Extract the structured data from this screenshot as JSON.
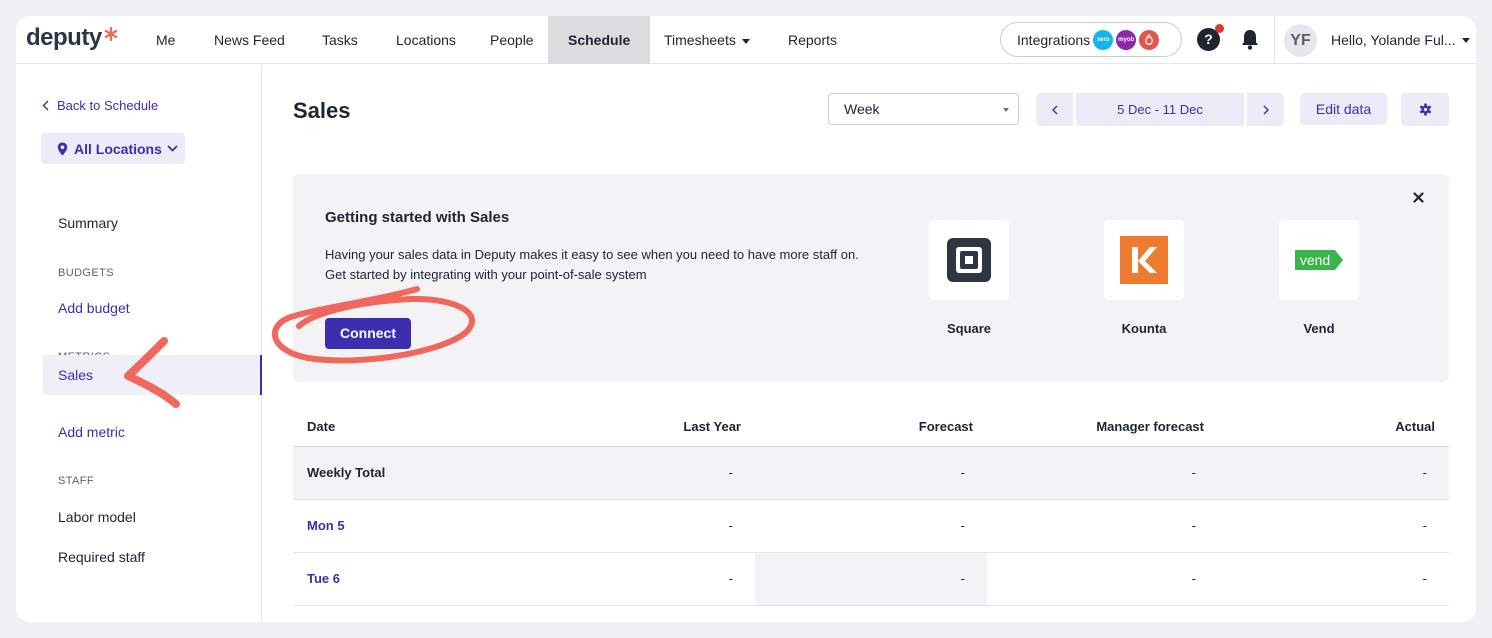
{
  "nav": {
    "brand": "deputy",
    "items": [
      {
        "label": "Me"
      },
      {
        "label": "News Feed"
      },
      {
        "label": "Tasks"
      },
      {
        "label": "Locations"
      },
      {
        "label": "People"
      },
      {
        "label": "Schedule"
      },
      {
        "label": "Timesheets"
      },
      {
        "label": "Reports"
      }
    ],
    "integrations_label": "Integrations",
    "integration_logos": [
      {
        "text": "xero",
        "color": "#13b5ea"
      },
      {
        "text": "myob",
        "color": "#8a2aa6"
      },
      {
        "text": "",
        "color": "#e2574c"
      }
    ],
    "help_icon": "?",
    "avatar_initials": "YF",
    "greeting": "Hello, Yolande Ful..."
  },
  "sidebar": {
    "back_label": "Back to Schedule",
    "location_label": "All Locations",
    "summary": "Summary",
    "budgets_heading": "BUDGETS",
    "add_budget": "Add budget",
    "metrics_heading": "METRICS",
    "sales": "Sales",
    "add_metric": "Add metric",
    "staff_heading": "STAFF",
    "labor_model": "Labor model",
    "required_staff": "Required staff"
  },
  "main": {
    "title": "Sales",
    "period_select": "Week",
    "date_range": "5 Dec - 11 Dec",
    "edit_label": "Edit data"
  },
  "card": {
    "title": "Getting started with Sales",
    "line1": "Having your sales data in Deputy makes it easy to see when you need to have more staff on.",
    "line2": "Get started by integrating with your point-of-sale system",
    "connect_label": "Connect",
    "vend_logo_text": "vend",
    "integrations": [
      {
        "name": "Square"
      },
      {
        "name": "Kounta"
      },
      {
        "name": "Vend"
      }
    ]
  },
  "table": {
    "headers": [
      "Date",
      "Last Year",
      "Forecast",
      "Manager forecast",
      "Actual"
    ],
    "rows": [
      {
        "date": "Weekly Total",
        "last_year": "-",
        "forecast": "-",
        "manager_forecast": "-",
        "actual": "-"
      },
      {
        "date": "Mon 5",
        "last_year": "-",
        "forecast": "-",
        "manager_forecast": "-",
        "actual": "-"
      },
      {
        "date": "Tue 6",
        "last_year": "-",
        "forecast": "-",
        "manager_forecast": "-",
        "actual": "-"
      }
    ]
  },
  "colors": {
    "accent": "#3d2eb0",
    "accent_light": "#ecebf7",
    "annotation": "#f0675e",
    "square": "#2f3641",
    "kounta": "#ee7b30",
    "vend": "#3bb44a"
  }
}
